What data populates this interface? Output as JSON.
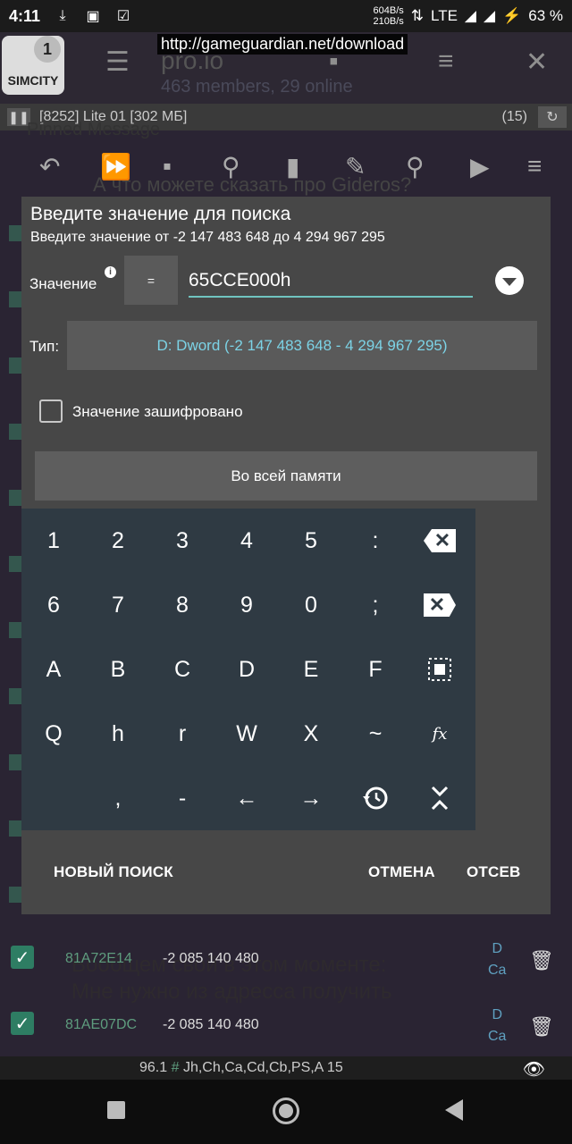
{
  "status_bar": {
    "time": "4:11",
    "net_up": "604B/s",
    "net_down": "210B/s",
    "network": "LTE",
    "battery": "63 %"
  },
  "background": {
    "url": "http://gameguardian.net/download",
    "app_icon_label": "SIMCITY",
    "app_icon_badge": "1",
    "group_title": "pro.io",
    "group_sub": "463 members, 29 online",
    "pinned": "Pinned Message",
    "question": "А что можете сказать про Gideros?",
    "process": "[8252] Lite 01 [302 МБ]",
    "result_count": "(15)",
    "message_1": "Вообщем свой в этом моменте:",
    "message_2": "Мне нужно из адресса получить"
  },
  "results": [
    {
      "address": "81A72E14",
      "value": "-2 085 140 480",
      "type_top": "D",
      "type_bottom": "Ca"
    },
    {
      "address": "81AE07DC",
      "value": "-2 085 140 480",
      "type_top": "D",
      "type_bottom": "Ca"
    }
  ],
  "info_bar": {
    "version": "96.1",
    "hash": "#",
    "regions": "Jh,Ch,Ca,Cd,Cb,PS,A 15"
  },
  "dialog": {
    "title": "Введите значение для поиска",
    "range": "Введите значение от -2 147 483 648 до 4 294 967 295",
    "value_label": "Значение",
    "eq_button": "=",
    "value": "65CCE000h",
    "type_label": "Тип:",
    "type_value": "D: Dword (-2 147 483 648 - 4 294 967 295)",
    "encrypted_label": "Значение зашифровано",
    "memory_button": "Во всей памяти",
    "new_search": "НОВЫЙ ПОИСК",
    "cancel": "ОТМЕНА",
    "filter": "ОТСЕВ"
  },
  "keyboard": {
    "row1": [
      "1",
      "2",
      "3",
      "4",
      "5",
      ":"
    ],
    "row2": [
      "6",
      "7",
      "8",
      "9",
      "0",
      ";"
    ],
    "row3": [
      "A",
      "B",
      "C",
      "D",
      "E",
      "F"
    ],
    "row4": [
      "Q",
      "h",
      "r",
      "W",
      "X",
      "~"
    ],
    "row5": [
      "",
      ",",
      "-",
      "←",
      "→"
    ]
  },
  "icons": [
    "pause-icon",
    "refresh-icon",
    "undo-icon",
    "fast-forward-icon",
    "save-icon",
    "search-question-icon",
    "delete-icon",
    "edit-icon",
    "search-icon",
    "play-icon",
    "menu-icon",
    "close-icon",
    "backspace-icon",
    "select-all-icon",
    "function-icon",
    "history-icon",
    "collapse-icon",
    "dropdown-icon",
    "eye-icon"
  ]
}
